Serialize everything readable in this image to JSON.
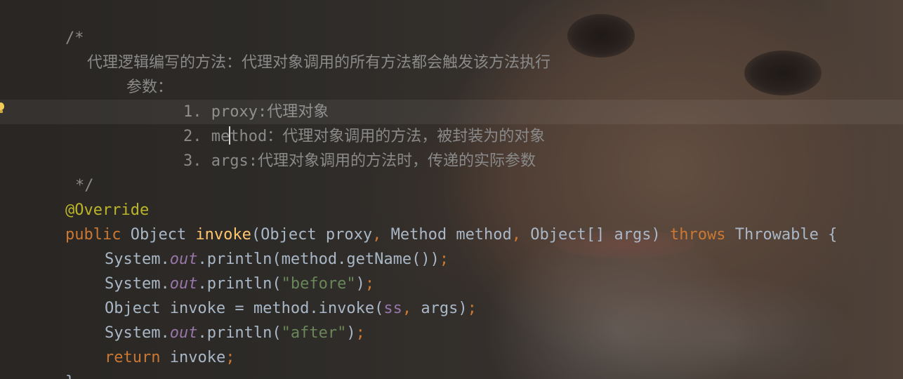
{
  "editor": {
    "colors": {
      "comment": "#8a8a8a",
      "keyword": "#cc7832",
      "annotation": "#bbb529",
      "method_decl": "#ffc66d",
      "string": "#6a8759",
      "static_field": "#9876aa",
      "text": "#a9b7c6",
      "intention_bulb": "#f2c94c"
    },
    "icons": [
      "intention-bulb-icon"
    ],
    "lines": {
      "l1": "/*",
      "l2": "代理逻辑编写的方法：代理对象调用的所有方法都会触发该方法执行",
      "l3": "参数：",
      "l4_num": "1. ",
      "l4_name": "proxy:",
      "l4_desc": "代理对象",
      "l5_num": "2. ",
      "l5_name_a": "me",
      "l5_name_b": "thod",
      "l5_desc": "：代理对象调用的方法，被封装为的对象",
      "l6_num": "3. ",
      "l6_name": "args:",
      "l6_desc": "代理对象调用的方法时，传递的实际参数",
      "l7": "*/",
      "l8": "@Override",
      "l9": {
        "public": "public",
        "type1": " Object ",
        "name": "invoke",
        "p1": "(Object proxy",
        "comma1": ",",
        "p2": " Method method",
        "comma2": ",",
        "p3": " Object[] args) ",
        "throws": "throws",
        "rest": " Throwable {"
      },
      "l10": {
        "a": "System.",
        "field": "out",
        "b": ".println(method.getName())",
        "semi": ";"
      },
      "l11": {
        "a": "System.",
        "field": "out",
        "b": ".println(",
        "str": "\"before\"",
        "c": ")",
        "semi": ";"
      },
      "l12": {
        "a": "Object invoke = method.invoke(",
        "field": "ss",
        "comma": ",",
        "b": " args)",
        "semi": ";"
      },
      "l13": {
        "a": "System.",
        "field": "out",
        "b": ".println(",
        "str": "\"after\"",
        "c": ")",
        "semi": ";"
      },
      "l14": {
        "kw": "return",
        "b": " invoke",
        "semi": ";"
      },
      "l15": "}"
    }
  }
}
